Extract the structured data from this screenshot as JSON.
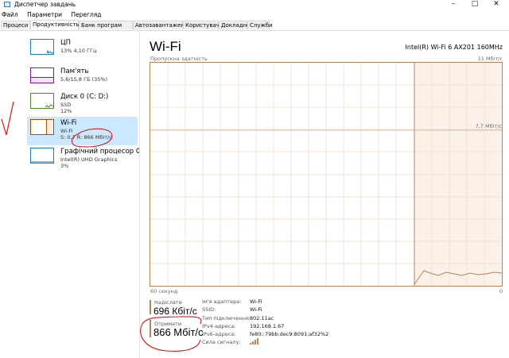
{
  "window": {
    "title": "Диспетчер завдань",
    "controls": [
      "–",
      "□",
      "✕"
    ]
  },
  "menu": [
    "Файл",
    "Параметри",
    "Перегляд"
  ],
  "tabs": [
    {
      "label": "Процеси",
      "active": false
    },
    {
      "label": "Продуктивність",
      "active": true
    },
    {
      "label": "Банк програм",
      "active": false
    },
    {
      "label": "Автозавантаження",
      "active": false
    },
    {
      "label": "Користувачі",
      "active": false
    },
    {
      "label": "Докладно",
      "active": false
    },
    {
      "label": "Служби",
      "active": false
    }
  ],
  "sidebar": {
    "items": [
      {
        "name": "ЦП",
        "lines": [
          "13% 4,10 ГГц"
        ],
        "color": "#1a7fc1",
        "active": false
      },
      {
        "name": "Пам'ять",
        "lines": [
          "5,6/15,8 ГБ (35%)"
        ],
        "color": "#8b12ae",
        "active": false
      },
      {
        "name": "Диск 0 (C: D:)",
        "lines": [
          "SSD",
          "12%"
        ],
        "color": "#4d8a24",
        "active": false
      },
      {
        "name": "Wi-Fi",
        "lines": [
          "Wi-Fi",
          "S: 0,7 R: 866 Мбіт/с"
        ],
        "color": "#a74f01",
        "active": true
      },
      {
        "name": "Графічний процесор 0",
        "lines": [
          "Intel(R) UHD Graphics",
          "3%"
        ],
        "color": "#1a7fc1",
        "active": false
      }
    ]
  },
  "main": {
    "title": "Wi-Fi",
    "adapter": "Intel(R) Wi-Fi 6 AX201 160MHz",
    "graph": {
      "label_throughput": "Пропускна здатність",
      "max_label": "11 Мбіт/с",
      "mid_label": "7,7 Мбіт/с",
      "time_label": "60 секунд",
      "zero_label": "0",
      "line_color": "#a74f01",
      "grid_color": "#f2e4d6"
    },
    "send": {
      "label": "Надіслати",
      "value": "696 Кбіт/с"
    },
    "receive": {
      "label": "Отримати",
      "value": "866 Мбіт/с"
    },
    "details": [
      {
        "key": "Ім'я адаптера:",
        "value": "Wi-Fi"
      },
      {
        "key": "SSID:",
        "value": "Wi-Fi"
      },
      {
        "key": "Тип підключення:",
        "value": "802.11ac"
      },
      {
        "key": "IPv4-адреса:",
        "value": "192.168.1.67"
      },
      {
        "key": "IPv6-адреса:",
        "value": "fe80::79bb:dec9:8091:af32%2"
      },
      {
        "key": "Сила сигналу:",
        "value": ""
      }
    ],
    "signal_strength_bars": 4
  }
}
